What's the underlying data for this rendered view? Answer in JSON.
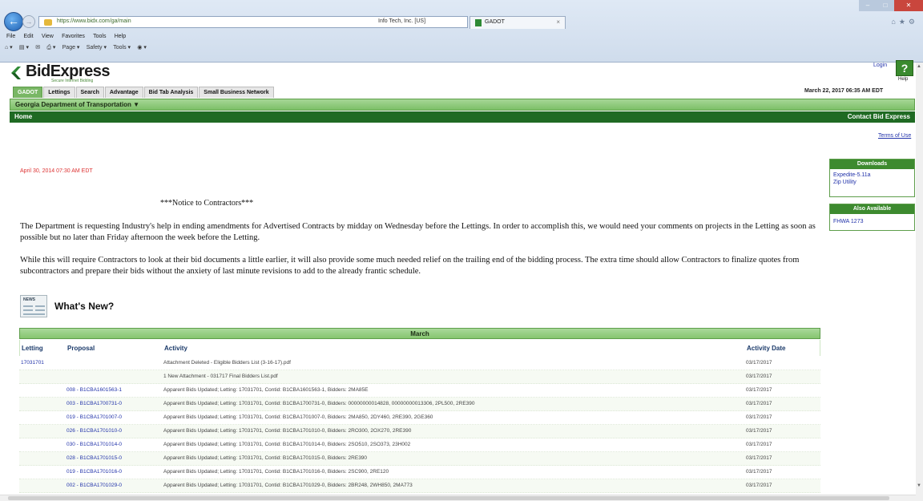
{
  "browser": {
    "url": "https://www.bidx.com/ga/main",
    "address_right": "Info Tech, Inc. [US]",
    "tab_title": "GADOT",
    "tab_close": "×",
    "menu": [
      "File",
      "Edit",
      "View",
      "Favorites",
      "Tools",
      "Help"
    ],
    "commands": [
      "Page ▾",
      "Safety ▾",
      "Tools ▾"
    ]
  },
  "header": {
    "logo": "BidExpress",
    "logo_sub": "Secure Internet Bidding",
    "login": "Login",
    "help_symbol": "?",
    "help": "Help",
    "date": "March 22, 2017 06:35 AM EDT"
  },
  "nav": {
    "tabs": [
      {
        "label": "GADOT",
        "active": true
      },
      {
        "label": "Lettings",
        "active": false
      },
      {
        "label": "Search",
        "active": false
      },
      {
        "label": "Advantage",
        "active": false
      },
      {
        "label": "Bid Tab Analysis",
        "active": false
      },
      {
        "label": "Small Business Network",
        "active": false
      }
    ],
    "agency": "Georgia Department of Transportation ▼",
    "home": "Home",
    "contact": "Contact Bid Express",
    "terms": "Terms of Use"
  },
  "sidebar": {
    "downloads": {
      "title": "Downloads",
      "items": [
        "Expedite-5.11a",
        "Zip Utility"
      ]
    },
    "also": {
      "title": "Also Available",
      "items": [
        "FHWA 1273"
      ]
    }
  },
  "notice": {
    "date": "April 30, 2014 07:30 AM EDT",
    "title": "***Notice to Contractors***",
    "p1": "The Department is requesting Industry's help in ending amendments for Advertised Contracts by midday on Wednesday before the Lettings.  In order to accomplish this, we would need your comments on projects in the Letting as soon as possible but no later than Friday afternoon the week before the Letting.",
    "p2": "While this will require Contractors to look at their bid documents a little earlier, it will also provide some much needed relief on the trailing end of the bidding process.  The extra time should allow Contractors to finalize quotes from subcontractors and prepare their bids without the anxiety of last minute revisions to add to the already frantic schedule."
  },
  "whats_new": {
    "icon_label": "NEWS",
    "title": "What's New?",
    "month": "March",
    "columns": {
      "letting": "Letting",
      "proposal": "Proposal",
      "activity": "Activity",
      "date": "Activity Date"
    },
    "rows": [
      {
        "letting": "17031701",
        "proposal": "",
        "activity": "Attachment Deleted - Eligible Bidders List (3-16-17).pdf",
        "date": "03/17/2017"
      },
      {
        "letting": "",
        "proposal": "",
        "activity": "1 New Attachment - 031717 Final Bidders List.pdf",
        "date": "03/17/2017"
      },
      {
        "letting": "",
        "proposal": "008 - B1CBA1601563-1",
        "activity": "Apparent Bids Updated; Letting: 17031701, Contid: B1CBA1601563-1, Bidders: 2MA85E",
        "date": "03/17/2017"
      },
      {
        "letting": "",
        "proposal": "003 - B1CBA1700731-0",
        "activity": "Apparent Bids Updated; Letting: 17031701, Contid: B1CBA1700731-0, Bidders: 00000000014828, 00000000013306, 2PL500, 2RE390",
        "date": "03/17/2017"
      },
      {
        "letting": "",
        "proposal": "019 - B1CBA1701007-0",
        "activity": "Apparent Bids Updated; Letting: 17031701, Contid: B1CBA1701007-0, Bidders: 2MA850, 2DY460, 2RE390, 2GE360",
        "date": "03/17/2017"
      },
      {
        "letting": "",
        "proposal": "026 - B1CBA1701010-0",
        "activity": "Apparent Bids Updated; Letting: 17031701, Contid: B1CBA1701010-0, Bidders: 2RO300, 2OX270, 2RE390",
        "date": "03/17/2017"
      },
      {
        "letting": "",
        "proposal": "030 - B1CBA1701014-0",
        "activity": "Apparent Bids Updated; Letting: 17031701, Contid: B1CBA1701014-0, Bidders: 2SO510, 2SO373, 23H002",
        "date": "03/17/2017"
      },
      {
        "letting": "",
        "proposal": "028 - B1CBA1701015-0",
        "activity": "Apparent Bids Updated; Letting: 17031701, Contid: B1CBA1701015-0, Bidders: 2RE390",
        "date": "03/17/2017"
      },
      {
        "letting": "",
        "proposal": "019 - B1CBA1701016-0",
        "activity": "Apparent Bids Updated; Letting: 17031701, Contid: B1CBA1701016-0, Bidders: 2SC900, 2RE120",
        "date": "03/17/2017"
      },
      {
        "letting": "",
        "proposal": "002 - B1CBA1701029-0",
        "activity": "Apparent Bids Updated; Letting: 17031701, Contid: B1CBA1701029-0, Bidders: 2BR248, 2WH850, 2MA773",
        "date": "03/17/2017"
      }
    ]
  },
  "colors": {
    "brand_green": "#3d8a2f",
    "dark_green": "#1f6a23",
    "link_blue": "#2233aa",
    "date_red": "#dd3333"
  }
}
